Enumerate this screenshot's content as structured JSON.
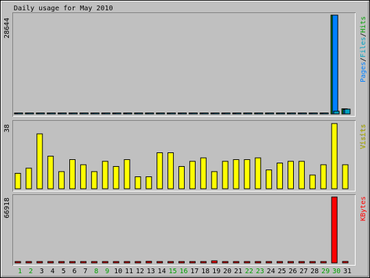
{
  "title": "Daily usage for May 2010",
  "colors": {
    "background": "#c0c0c0",
    "pages": "#0080ff",
    "files": "#00a0c0",
    "hits": "#00a000",
    "visits": "#ffff00",
    "kbytes": "#ff0000",
    "weekend_label": "#00a000",
    "weekday_label": "#000000"
  },
  "chart_data": [
    {
      "type": "bar",
      "panel": "hits",
      "ymax_label": "28644",
      "ylim": [
        0,
        28644
      ],
      "legend": [
        "Pages",
        "/",
        "Files",
        "/",
        "Hits"
      ],
      "categories": [
        "1",
        "2",
        "3",
        "4",
        "5",
        "6",
        "7",
        "8",
        "9",
        "10",
        "11",
        "12",
        "13",
        "14",
        "15",
        "16",
        "17",
        "18",
        "19",
        "20",
        "21",
        "22",
        "23",
        "24",
        "25",
        "26",
        "27",
        "28",
        "29",
        "30",
        "31"
      ],
      "series": [
        {
          "name": "Hits",
          "values": [
            260,
            110,
            220,
            100,
            120,
            130,
            110,
            100,
            110,
            100,
            90,
            80,
            90,
            100,
            110,
            300,
            100,
            120,
            260,
            120,
            100,
            100,
            110,
            100,
            120,
            130,
            120,
            100,
            100,
            28644,
            1500
          ]
        },
        {
          "name": "Files",
          "values": [
            220,
            90,
            200,
            90,
            100,
            110,
            90,
            80,
            90,
            80,
            80,
            70,
            80,
            90,
            90,
            260,
            90,
            100,
            230,
            100,
            90,
            90,
            90,
            90,
            100,
            110,
            100,
            80,
            80,
            800,
            1400
          ]
        },
        {
          "name": "Pages",
          "values": [
            200,
            80,
            180,
            80,
            90,
            100,
            80,
            70,
            80,
            70,
            70,
            60,
            70,
            80,
            80,
            240,
            80,
            90,
            200,
            90,
            80,
            80,
            80,
            80,
            90,
            100,
            90,
            70,
            70,
            28644,
            1300
          ]
        }
      ]
    },
    {
      "type": "bar",
      "panel": "visits",
      "ymax_label": "38",
      "ylim": [
        0,
        38
      ],
      "legend": [
        "Visits"
      ],
      "categories": [
        "1",
        "2",
        "3",
        "4",
        "5",
        "6",
        "7",
        "8",
        "9",
        "10",
        "11",
        "12",
        "13",
        "14",
        "15",
        "16",
        "17",
        "18",
        "19",
        "20",
        "21",
        "22",
        "23",
        "24",
        "25",
        "26",
        "27",
        "28",
        "29",
        "30",
        "31"
      ],
      "series": [
        {
          "name": "Visits",
          "values": [
            9,
            12,
            32,
            19,
            10,
            17,
            14,
            10,
            16,
            13,
            17,
            7,
            7,
            21,
            21,
            13,
            16,
            18,
            10,
            16,
            17,
            17,
            18,
            11,
            15,
            16,
            16,
            8,
            14,
            38,
            14
          ]
        }
      ]
    },
    {
      "type": "bar",
      "panel": "kbytes",
      "ymax_label": "66918",
      "ylim": [
        0,
        66918
      ],
      "legend": [
        "KBytes"
      ],
      "categories": [
        "1",
        "2",
        "3",
        "4",
        "5",
        "6",
        "7",
        "8",
        "9",
        "10",
        "11",
        "12",
        "13",
        "14",
        "15",
        "16",
        "17",
        "18",
        "19",
        "20",
        "21",
        "22",
        "23",
        "24",
        "25",
        "26",
        "27",
        "28",
        "29",
        "30",
        "31"
      ],
      "series": [
        {
          "name": "KBytes",
          "values": [
            600,
            600,
            600,
            300,
            300,
            600,
            300,
            600,
            600,
            600,
            300,
            300,
            1600,
            600,
            300,
            900,
            600,
            300,
            2100,
            600,
            600,
            300,
            300,
            300,
            1000,
            300,
            1400,
            300,
            300,
            66918,
            1500
          ]
        }
      ]
    }
  ],
  "x_labels": [
    {
      "text": "1",
      "weekend": true
    },
    {
      "text": "2",
      "weekend": true
    },
    {
      "text": "3",
      "weekend": false
    },
    {
      "text": "4",
      "weekend": false
    },
    {
      "text": "5",
      "weekend": false
    },
    {
      "text": "6",
      "weekend": false
    },
    {
      "text": "7",
      "weekend": false
    },
    {
      "text": "8",
      "weekend": true
    },
    {
      "text": "9",
      "weekend": true
    },
    {
      "text": "10",
      "weekend": false
    },
    {
      "text": "11",
      "weekend": false
    },
    {
      "text": "12",
      "weekend": false
    },
    {
      "text": "13",
      "weekend": false
    },
    {
      "text": "14",
      "weekend": false
    },
    {
      "text": "15",
      "weekend": true
    },
    {
      "text": "16",
      "weekend": true
    },
    {
      "text": "17",
      "weekend": false
    },
    {
      "text": "18",
      "weekend": false
    },
    {
      "text": "19",
      "weekend": false
    },
    {
      "text": "20",
      "weekend": false
    },
    {
      "text": "21",
      "weekend": false
    },
    {
      "text": "22",
      "weekend": true
    },
    {
      "text": "23",
      "weekend": true
    },
    {
      "text": "24",
      "weekend": false
    },
    {
      "text": "25",
      "weekend": false
    },
    {
      "text": "26",
      "weekend": false
    },
    {
      "text": "27",
      "weekend": false
    },
    {
      "text": "28",
      "weekend": false
    },
    {
      "text": "29",
      "weekend": true
    },
    {
      "text": "30",
      "weekend": true
    },
    {
      "text": "31",
      "weekend": false
    }
  ]
}
